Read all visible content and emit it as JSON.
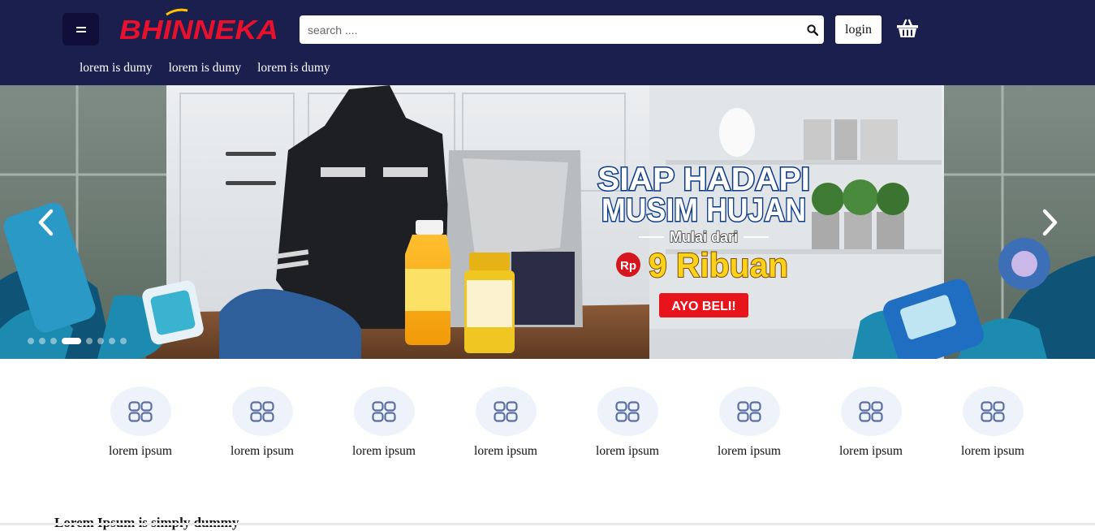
{
  "header": {
    "brand": "BHINNEKA",
    "search_placeholder": "search ....",
    "login_label": "login",
    "nav": [
      "lorem is dumy",
      "lorem is dumy",
      "lorem is dumy"
    ],
    "icons": {
      "menu": "menu-icon",
      "search": "search-icon",
      "cart": "basket-icon"
    }
  },
  "banner": {
    "headline_1": "SIAP HADAPI",
    "headline_2": "MUSIM HUJAN",
    "subline": "Mulai dari",
    "currency": "Rp",
    "price": "9 Ribuan",
    "cta": "AYO BELI!",
    "slide_count": 8,
    "active_slide": 4
  },
  "categories": [
    {
      "label": "lorem ipsum",
      "icon": "grid-icon"
    },
    {
      "label": "lorem ipsum",
      "icon": "grid-icon"
    },
    {
      "label": "lorem ipsum",
      "icon": "grid-icon"
    },
    {
      "label": "lorem ipsum",
      "icon": "grid-icon"
    },
    {
      "label": "lorem ipsum",
      "icon": "grid-icon"
    },
    {
      "label": "lorem ipsum",
      "icon": "grid-icon"
    },
    {
      "label": "lorem ipsum",
      "icon": "grid-icon"
    },
    {
      "label": "lorem ipsum",
      "icon": "grid-icon"
    }
  ],
  "section": {
    "title": "Lorem Ipsum is simply dummy"
  },
  "colors": {
    "header_bg": "#1b1f4d",
    "brand_red": "#e8112d",
    "brand_yellow": "#ffc400",
    "cta_red": "#e8141c"
  }
}
